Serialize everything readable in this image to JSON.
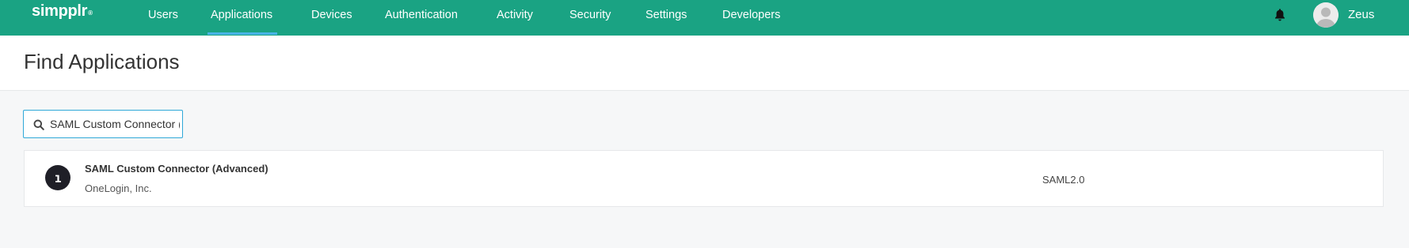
{
  "brand": {
    "logo_text": "simpplr",
    "logo_mark": "®"
  },
  "nav": {
    "items": [
      {
        "label": "Users"
      },
      {
        "label": "Applications",
        "active": true
      },
      {
        "label": "Devices"
      },
      {
        "label": "Authentication"
      },
      {
        "label": "Activity"
      },
      {
        "label": "Security"
      },
      {
        "label": "Settings"
      },
      {
        "label": "Developers"
      }
    ],
    "bell_icon": "bell-icon",
    "user": {
      "name": "Zeus",
      "avatar_icon": "user-avatar-icon"
    }
  },
  "page": {
    "title": "Find Applications"
  },
  "search": {
    "icon": "search-icon",
    "value": "SAML Custom Connector (Advanced)"
  },
  "results": [
    {
      "name": "SAML Custom Connector (Advanced)",
      "vendor": "OneLogin, Inc.",
      "type": "SAML2.0",
      "logo_icon": "onelogin-logo-icon"
    }
  ],
  "colors": {
    "topbar": "#1aa383",
    "active_underline": "#47b4e6",
    "search_border": "#2fa8d8",
    "background": "#f6f7f8",
    "app_logo": "#1f1f27"
  }
}
